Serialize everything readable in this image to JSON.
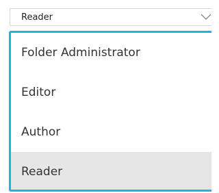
{
  "select": {
    "value": "Reader",
    "chevron_icon": "chevron-down-icon"
  },
  "dropdown": {
    "accent_color": "#1fb3e0",
    "selected_index": 3,
    "options": [
      {
        "label": "Folder Administrator"
      },
      {
        "label": "Editor"
      },
      {
        "label": "Author"
      },
      {
        "label": "Reader"
      }
    ]
  }
}
